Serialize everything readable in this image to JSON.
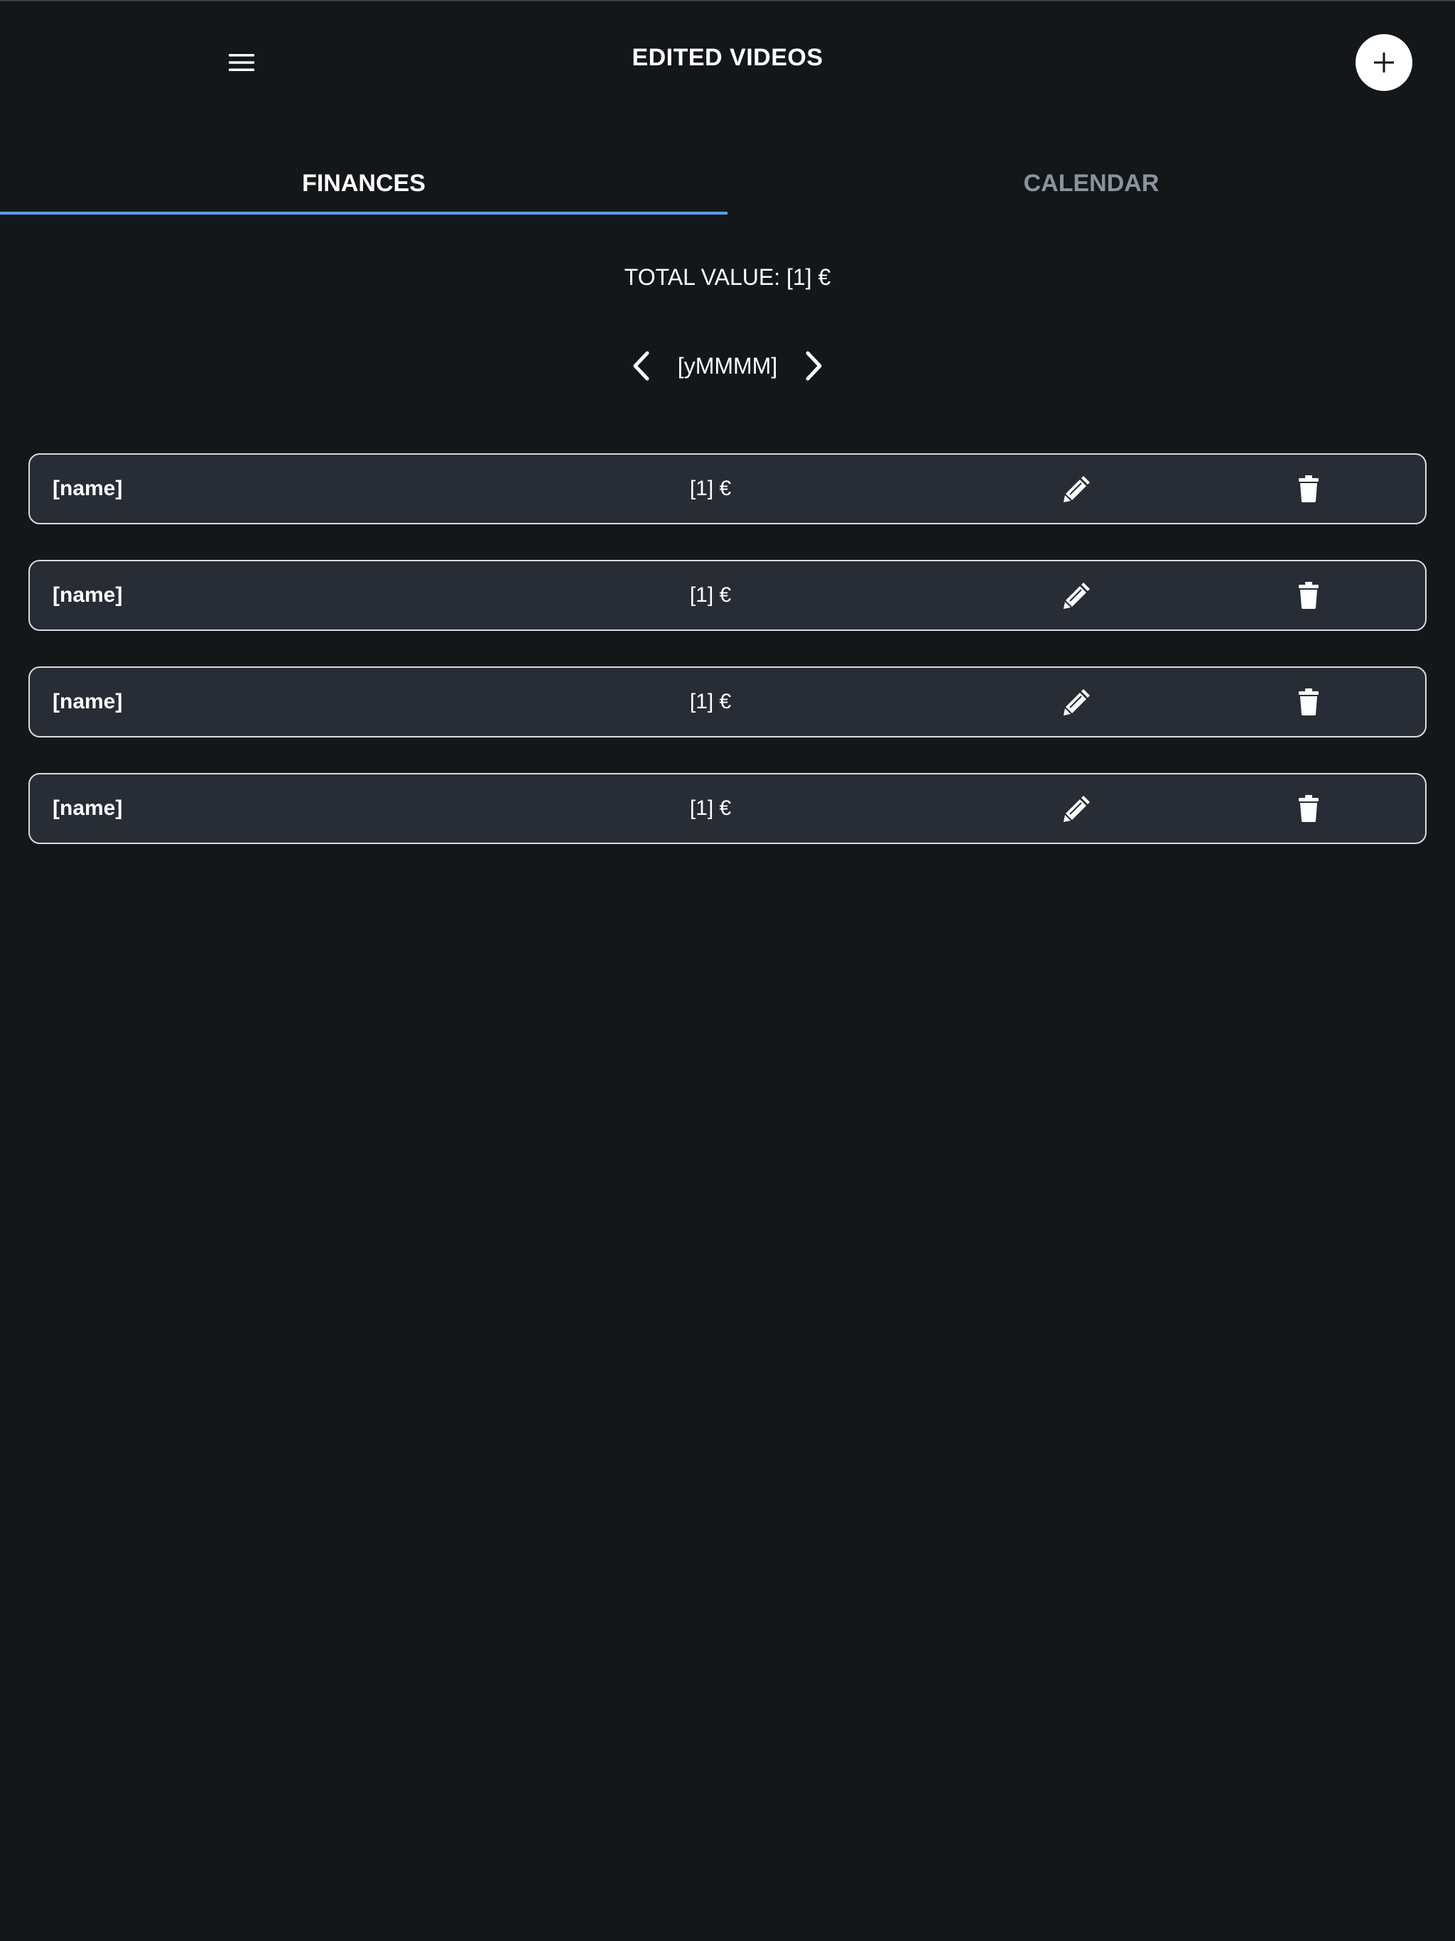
{
  "header": {
    "title": "EDITED VIDEOS",
    "menu_icon": "menu-icon",
    "add_icon": "plus-icon"
  },
  "tabs": [
    {
      "label": "FINANCES",
      "active": true
    },
    {
      "label": "CALENDAR",
      "active": false
    }
  ],
  "summary": {
    "total_value": "TOTAL VALUE: [1] €"
  },
  "month_nav": {
    "label": "[yMMMM]",
    "prev_icon": "chevron-left-icon",
    "next_icon": "chevron-right-icon"
  },
  "items": [
    {
      "name": "[name]",
      "value": "[1] €"
    },
    {
      "name": "[name]",
      "value": "[1] €"
    },
    {
      "name": "[name]",
      "value": "[1] €"
    },
    {
      "name": "[name]",
      "value": "[1] €"
    }
  ],
  "colors": {
    "background": "#14171a",
    "card": "#282d35",
    "card_border": "#d9dde2",
    "tab_indicator": "#5b9ee6",
    "inactive_tab": "#8b949c"
  }
}
